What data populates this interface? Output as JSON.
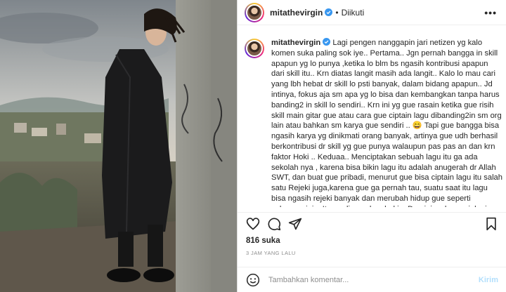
{
  "post": {
    "username": "mitathevirgin",
    "separator": "•",
    "follow_status": "Diikuti",
    "more_icon": "more-dots-icon"
  },
  "caption": {
    "username": "mitathevirgin",
    "text": "Lagi pengen nanggapin jari netizen yg kalo komen suka paling sok iye.. Pertama.. Jgn pernah bangga in skill apapun yg lo punya ,ketika lo blm bs ngasih kontribusi apapun dari skill itu.. Krn diatas langit masih ada langit.. Kalo lo mau cari yang lbh hebat dr skill lo psti banyak, dalam bidang apapun.. Jd intinya, fokus aja sm apa yg lo bisa dan kembangkan tanpa harus banding2 in skill lo sendiri.. Krn ini yg gue rasain ketika gue risih skill main gitar gue atau cara gue ciptain lagu dibanding2in sm org lain atau bahkan sm karya gue sendiri .. 😄 Tapi gue bangga bisa ngasih karya yg dinikmati orang banyak, artinya gue udh berhasil berkontribusi dr skill yg gue punya walaupun pas pas an dan krn faktor Hoki .. Keduaa.. Menciptakan sebuah lagu itu ga ada sekolah nya , karena bisa bikin lagu itu adalah anugerah dr Allah SWT, dan buat gue pribadi, menurut gue bisa ciptain lagu itu salah satu Rejeki juga,karena gue ga pernah tau, suatu saat itu lagu bisa ngasih rejeki banyak dan merubah hidup gue seperti sekarang ini .. Itu yg dinamakan hoki .. Dan ini yg lo gue jalanin sampe skrg.. Gue ga prnh tau kapan karya yg"
  },
  "actions": {
    "like_icon": "heart-icon",
    "comment_icon": "comment-icon",
    "share_icon": "share-icon",
    "save_icon": "bookmark-icon"
  },
  "likes_text": "816 suka",
  "timestamp": "3 JAM YANG LALU",
  "comment_box": {
    "placeholder": "Tambahkan komentar...",
    "post_label": "Kirim",
    "emoji_icon": "emoji-icon"
  },
  "colors": {
    "verified": "#3897f0",
    "post_button_disabled": "#b2dffc",
    "muted_text": "#8e8e8e"
  }
}
